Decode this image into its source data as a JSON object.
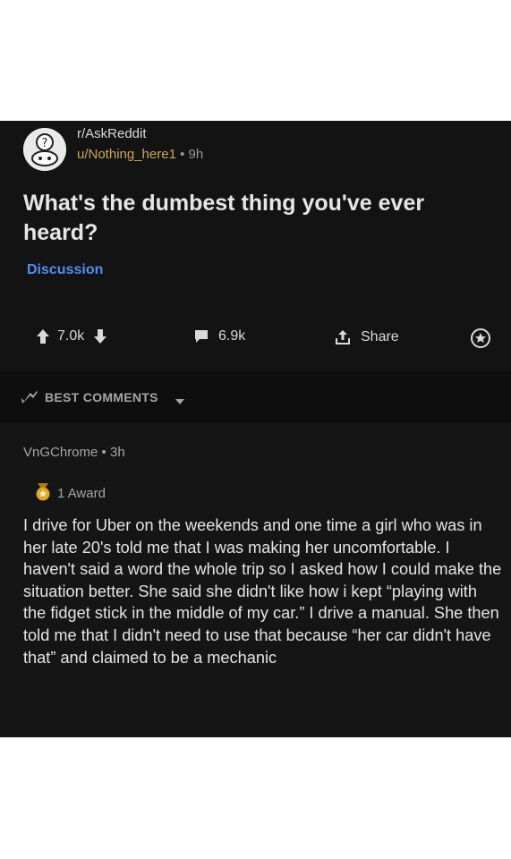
{
  "post": {
    "subreddit": "r/AskReddit",
    "author": "u/Nothing_here1",
    "separator": "•",
    "age": "9h",
    "title": "What's the dumbest thing you've ever heard?",
    "flair": "Discussion"
  },
  "actions": {
    "score": "7.0k",
    "comments": "6.9k",
    "share_label": "Share"
  },
  "sort": {
    "label": "BEST COMMENTS"
  },
  "comment": {
    "author": "VnGChrome",
    "separator": "•",
    "age": "3h",
    "award": "1 Award",
    "body": "I drive for Uber on the weekends and one time a girl who was in her late 20's told me that I was making her uncomfortable. I haven't said a word the whole trip so I asked how I could make the situation better. She said she didn't like how i kept “playing with the fidget stick in the middle of my car.” I drive a manual. She then told me that I didn't need to use that because “her car didn't have that” and claimed to be a mechanic"
  },
  "colors": {
    "background": "#0b0b0c",
    "flair": "#4f8ff2",
    "username": "#c8a85a",
    "award": "#e0a62a"
  },
  "icons": [
    "subreddit-avatar-icon",
    "upvote-icon",
    "downvote-icon",
    "comment-icon",
    "share-icon",
    "award-button-icon",
    "best-comments-icon",
    "chevron-down-icon",
    "award-medal-icon"
  ]
}
